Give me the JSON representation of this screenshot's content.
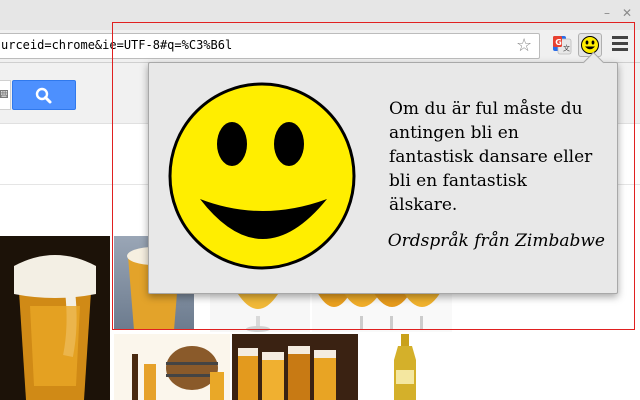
{
  "browser": {
    "window_controls": {
      "minimize_glyph": "–",
      "close_glyph": "✕"
    },
    "toolbar": {
      "url": "urceid=chrome&ie=UTF-8#q=%C3%B6l",
      "star_icon": "star-outline-icon",
      "extensions": [
        {
          "name": "translate-extension-icon"
        },
        {
          "name": "smiley-extension-icon"
        }
      ],
      "menu_icon": "hamburger-menu-icon"
    }
  },
  "page": {
    "search_button_icon": "magnifier-icon"
  },
  "popup": {
    "image": "smiley-face",
    "quote": "Om du är ful måste du antingen bli en fantastisk dansare eller bli en fantastisk älskare.",
    "attribution": "Ordspråk från Zimbabwe"
  },
  "colors": {
    "smiley_fill": "#ffee00",
    "search_button": "#4d90fe",
    "focus_frame": "#e02020"
  }
}
